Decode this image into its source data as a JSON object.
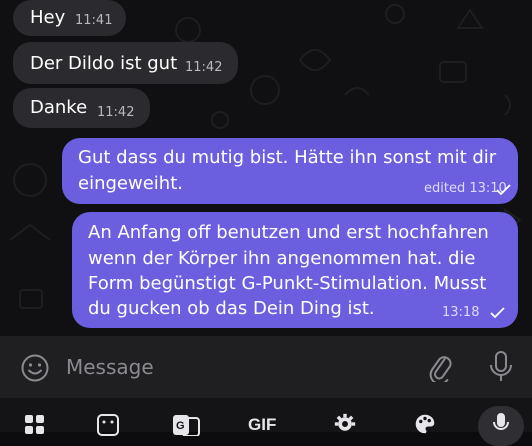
{
  "messages": [
    {
      "text": "Hey",
      "time": "11:41"
    },
    {
      "text": "Der Dildo ist gut",
      "time": "11:42"
    },
    {
      "text": "Danke",
      "time": "11:42"
    },
    {
      "lines": [
        "Gut dass du mutig bist. Hätte ihn sonst mit dir",
        "eingeweiht."
      ],
      "time": "edited 13:10"
    },
    {
      "lines": [
        "An Anfang off benutzen und erst hochfahren",
        "wenn der Körper ihn angenommen hat. die",
        "Form begünstigt G-Punkt-Stimulation. Musst",
        "du gucken ob das Dein Ding ist."
      ],
      "time": "13:18"
    }
  ],
  "composer": {
    "placeholder": "Message"
  },
  "keyboard": {
    "gif_label": "GIF"
  },
  "colors": {
    "outgoing": "#6b5fe0",
    "incoming": "#2b2b2f",
    "background": "#101012"
  }
}
